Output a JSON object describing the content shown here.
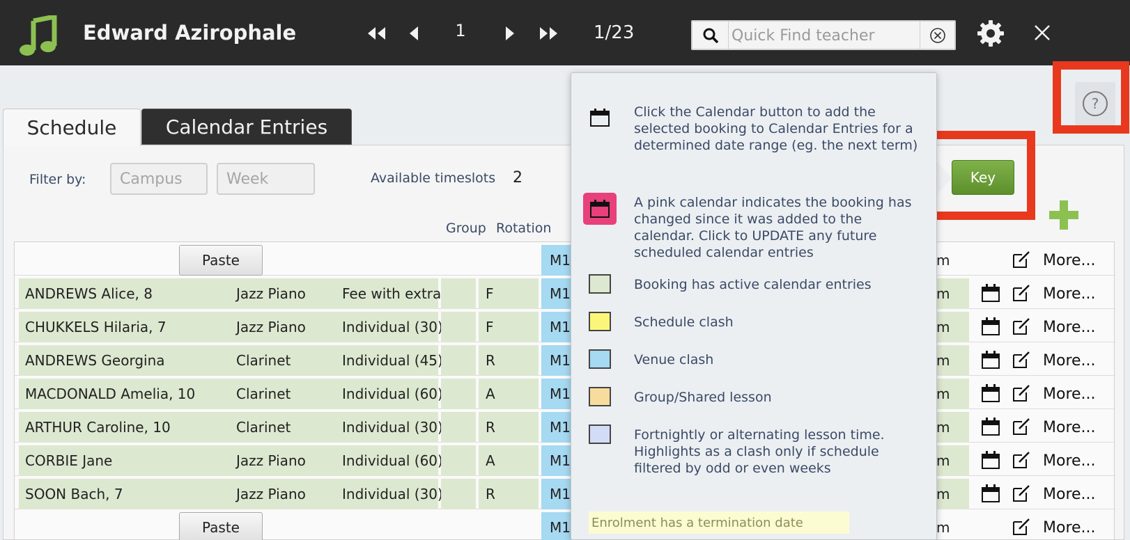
{
  "header": {
    "teacher_name": "Edward Azirophale",
    "page_number": "1",
    "page_count": "1/23",
    "search_placeholder": "Quick Find teacher"
  },
  "tabs": {
    "schedule": "Schedule",
    "calendar_entries": "Calendar Entries"
  },
  "filters": {
    "label": "Filter by:",
    "campus_placeholder": "Campus",
    "week_placeholder": "Week",
    "timeslots_label": "Available timeslots",
    "timeslots_value": "2"
  },
  "columns": {
    "group": "Group",
    "rotation": "Rotation"
  },
  "table": {
    "paste_label": "Paste",
    "more_label": "More...",
    "m_label": "M1",
    "time_suffix": "m",
    "rows": [
      {
        "student": "ANDREWS Alice, 8",
        "instrument": "Jazz Piano",
        "lesson": "Fee with extra",
        "rotation": "F"
      },
      {
        "student": "CHUKKELS Hilaria, 7",
        "instrument": "Jazz Piano",
        "lesson": "Individual (30)",
        "rotation": "F"
      },
      {
        "student": "ANDREWS Georgina",
        "instrument": "Clarinet",
        "lesson": "Individual (45)",
        "rotation": "R"
      },
      {
        "student": "MACDONALD Amelia, 10",
        "instrument": "Clarinet",
        "lesson": "Individual (60)",
        "rotation": "A"
      },
      {
        "student": "ARTHUR Caroline, 10",
        "instrument": "Clarinet",
        "lesson": "Individual (30)",
        "rotation": "R"
      },
      {
        "student": "CORBIE Jane",
        "instrument": "Jazz Piano",
        "lesson": "Individual (60)",
        "rotation": "A"
      },
      {
        "student": "SOON Bach, 7",
        "instrument": "Jazz Piano",
        "lesson": "Individual (30)",
        "rotation": "R"
      }
    ]
  },
  "key_button": "Key",
  "key_popup": {
    "calendar_text": "Click the Calendar button to add the selected booking to Calendar Entries for a determined date range (eg. the next term)",
    "pink_text": "A pink calendar indicates the booking has changed since it was added to the calendar. Click to UPDATE any future scheduled calendar entries",
    "items": [
      {
        "label": "Booking has active calendar entries",
        "color": "#dde8d0"
      },
      {
        "label": "Schedule clash",
        "color": "#fbf67a"
      },
      {
        "label": "Venue clash",
        "color": "#a6d9f2"
      },
      {
        "label": "Group/Shared lesson",
        "color": "#f7dc9e"
      },
      {
        "label": "Fortnightly or alternating lesson time. Highlights as a clash only if schedule filtered by odd or even weeks",
        "color": "#d3dcf6"
      }
    ],
    "termination": "Enrolment has a termination date"
  },
  "colors": {
    "accent_green": "#6aa13a",
    "highlight_red": "#e8391f",
    "pink_calendar": "#e8407a"
  }
}
